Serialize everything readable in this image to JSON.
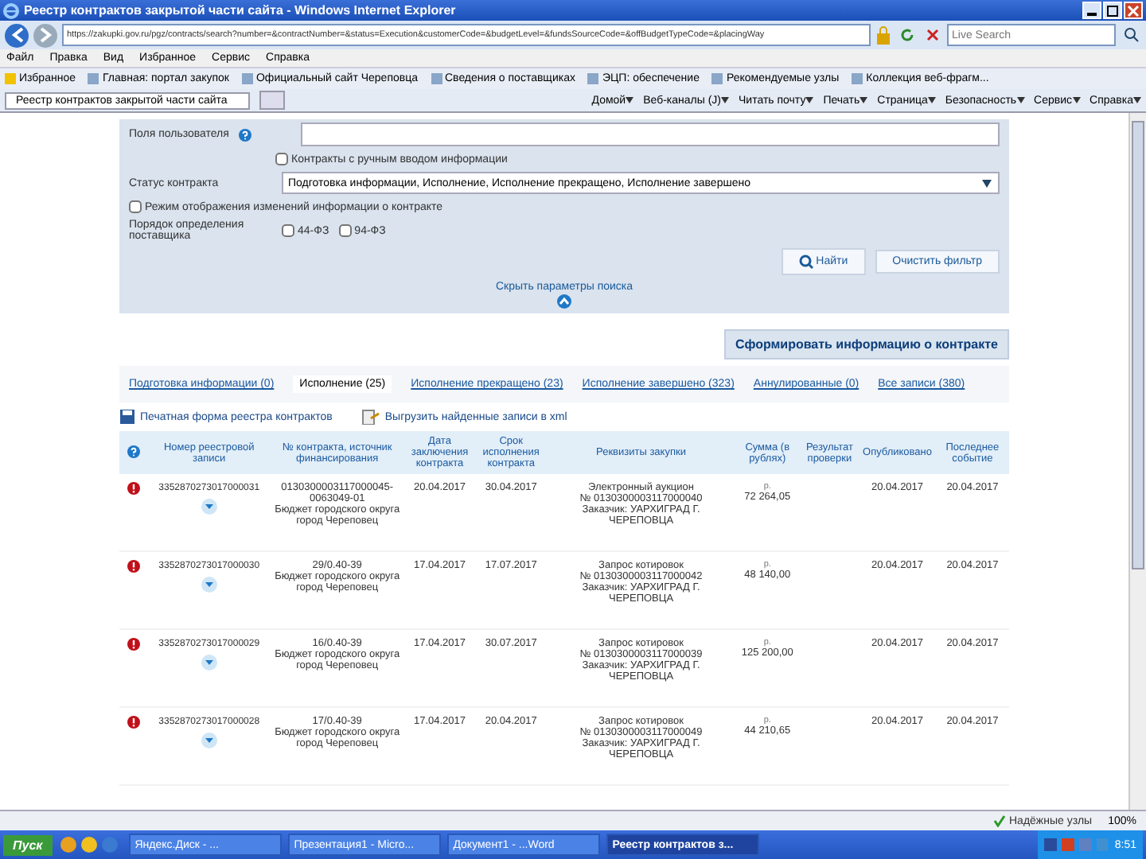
{
  "window": {
    "title": "Реестр контрактов закрытой части сайта - Windows Internet Explorer"
  },
  "address_bar": {
    "url": "https://zakupki.gov.ru/pgz/contracts/search?number=&contractNumber=&status=Execution&customerCode=&budgetLevel=&fundsSourceCode=&offBudgetTypeCode=&placingWay"
  },
  "search": {
    "placeholder": "Live Search"
  },
  "menu": [
    {
      "label": "Файл"
    },
    {
      "label": "Правка"
    },
    {
      "label": "Вид"
    },
    {
      "label": "Избранное"
    },
    {
      "label": "Сервис"
    },
    {
      "label": "Справка"
    }
  ],
  "favorites": [
    {
      "label": "Избранное"
    },
    {
      "label": "Главная: портал закупок"
    },
    {
      "label": "Официальный сайт Череповца"
    },
    {
      "label": "Сведения о поставщиках"
    },
    {
      "label": "ЭЦП: обеспечение"
    },
    {
      "label": "Рекомендуемые узлы"
    },
    {
      "label": "Коллекция веб-фрагм..."
    }
  ],
  "browser_tab": {
    "label": "Реестр контрактов закрытой части сайта"
  },
  "command_bar": [
    {
      "label": "Домой"
    },
    {
      "label": "Веб-каналы (J)"
    },
    {
      "label": "Читать почту"
    },
    {
      "label": "Печать"
    },
    {
      "label": "Страница"
    },
    {
      "label": "Безопасность"
    },
    {
      "label": "Сервис"
    },
    {
      "label": "Справка"
    }
  ],
  "filter": {
    "user_field_label": "Поля пользователя",
    "manual_checkbox": {
      "label": "Контракты с ручным вводом информации",
      "checked": false
    },
    "status_label": "Статус контракта",
    "status_value": "Подготовка информации, Исполнение, Исполнение прекращено, Исполнение завершено",
    "changes_checkbox": {
      "label": "Режим отображения изменений информации о контракте",
      "checked": false
    },
    "procedure_label": "Порядок определения поставщика",
    "procedure_options": [
      {
        "label": "44-ФЗ",
        "checked": false
      },
      {
        "label": "94-ФЗ",
        "checked": false
      }
    ],
    "find_button": "Найти",
    "clear_button": "Очистить фильтр",
    "hide_link": "Скрыть параметры поиска"
  },
  "form_button": "Сформировать информацию о контракте",
  "tabs": [
    {
      "label": "Подготовка информации (0)",
      "selected": false
    },
    {
      "label": "Исполнение (25)",
      "selected": true
    },
    {
      "label": "Исполнение прекращено (23)",
      "selected": false
    },
    {
      "label": "Исполнение завершено (323)",
      "selected": false
    },
    {
      "label": "Аннулированные (0)",
      "selected": false
    },
    {
      "label": "Все записи (380)",
      "selected": false
    }
  ],
  "actions": [
    {
      "label": "Печатная форма реестра контрактов"
    },
    {
      "label": "Выгрузить найденные записи в xml"
    }
  ],
  "table": {
    "columns": [
      "Номер реестровой записи",
      "№ контракта, источник финансирования",
      "Дата заключения контракта",
      "Срок исполнения контракта",
      "Реквизиты закупки",
      "Сумма (в рублях)",
      "Результат проверки",
      "Опубликовано",
      "Последнее событие"
    ],
    "rows": [
      {
        "number": "3352870273017000031",
        "contract": "0130300003117000045-0063049-01",
        "source": "Бюджет городского округа город Череповец",
        "date": "20.04.2017",
        "term": "30.04.2017",
        "method": "Электронный аукцион",
        "notice": "№ 0130300003117000040",
        "customer": "Заказчик: УАРХИГРАД Г. ЧЕРЕПОВЦА",
        "currency": "р.",
        "sum": "72 264,05",
        "published": "20.04.2017",
        "last_event": "20.04.2017"
      },
      {
        "number": "3352870273017000030",
        "contract": "29/0.40-39",
        "source": "Бюджет городского округа город Череповец",
        "date": "17.04.2017",
        "term": "17.07.2017",
        "method": "Запрос котировок",
        "notice": "№ 0130300003117000042",
        "customer": "Заказчик: УАРХИГРАД Г. ЧЕРЕПОВЦА",
        "currency": "р.",
        "sum": "48 140,00",
        "published": "20.04.2017",
        "last_event": "20.04.2017"
      },
      {
        "number": "3352870273017000029",
        "contract": "16/0.40-39",
        "source": "Бюджет городского округа город Череповец",
        "date": "17.04.2017",
        "term": "30.07.2017",
        "method": "Запрос котировок",
        "notice": "№ 0130300003117000039",
        "customer": "Заказчик: УАРХИГРАД Г. ЧЕРЕПОВЦА",
        "currency": "р.",
        "sum": "125 200,00",
        "published": "20.04.2017",
        "last_event": "20.04.2017"
      },
      {
        "number": "3352870273017000028",
        "contract": "17/0.40-39",
        "source": "Бюджет городского округа город Череповец",
        "date": "17.04.2017",
        "term": "20.04.2017",
        "method": "Запрос котировок",
        "notice": "№ 0130300003117000049",
        "customer": "Заказчик: УАРХИГРАД Г. ЧЕРЕПОВЦА",
        "currency": "р.",
        "sum": "44 210,65",
        "published": "20.04.2017",
        "last_event": "20.04.2017"
      }
    ]
  },
  "status_bar": {
    "zone": "Надёжные узлы",
    "zoom": "100%"
  },
  "taskbar": {
    "start": "Пуск",
    "tasks": [
      {
        "label": "Яндекс.Диск - ...",
        "selected": false
      },
      {
        "label": "Презентация1 - Micro...",
        "selected": false
      },
      {
        "label": "Документ1 - ...Word",
        "selected": false
      },
      {
        "label": "Реестр контрактов з...",
        "selected": true
      }
    ],
    "clock": "8:51"
  }
}
